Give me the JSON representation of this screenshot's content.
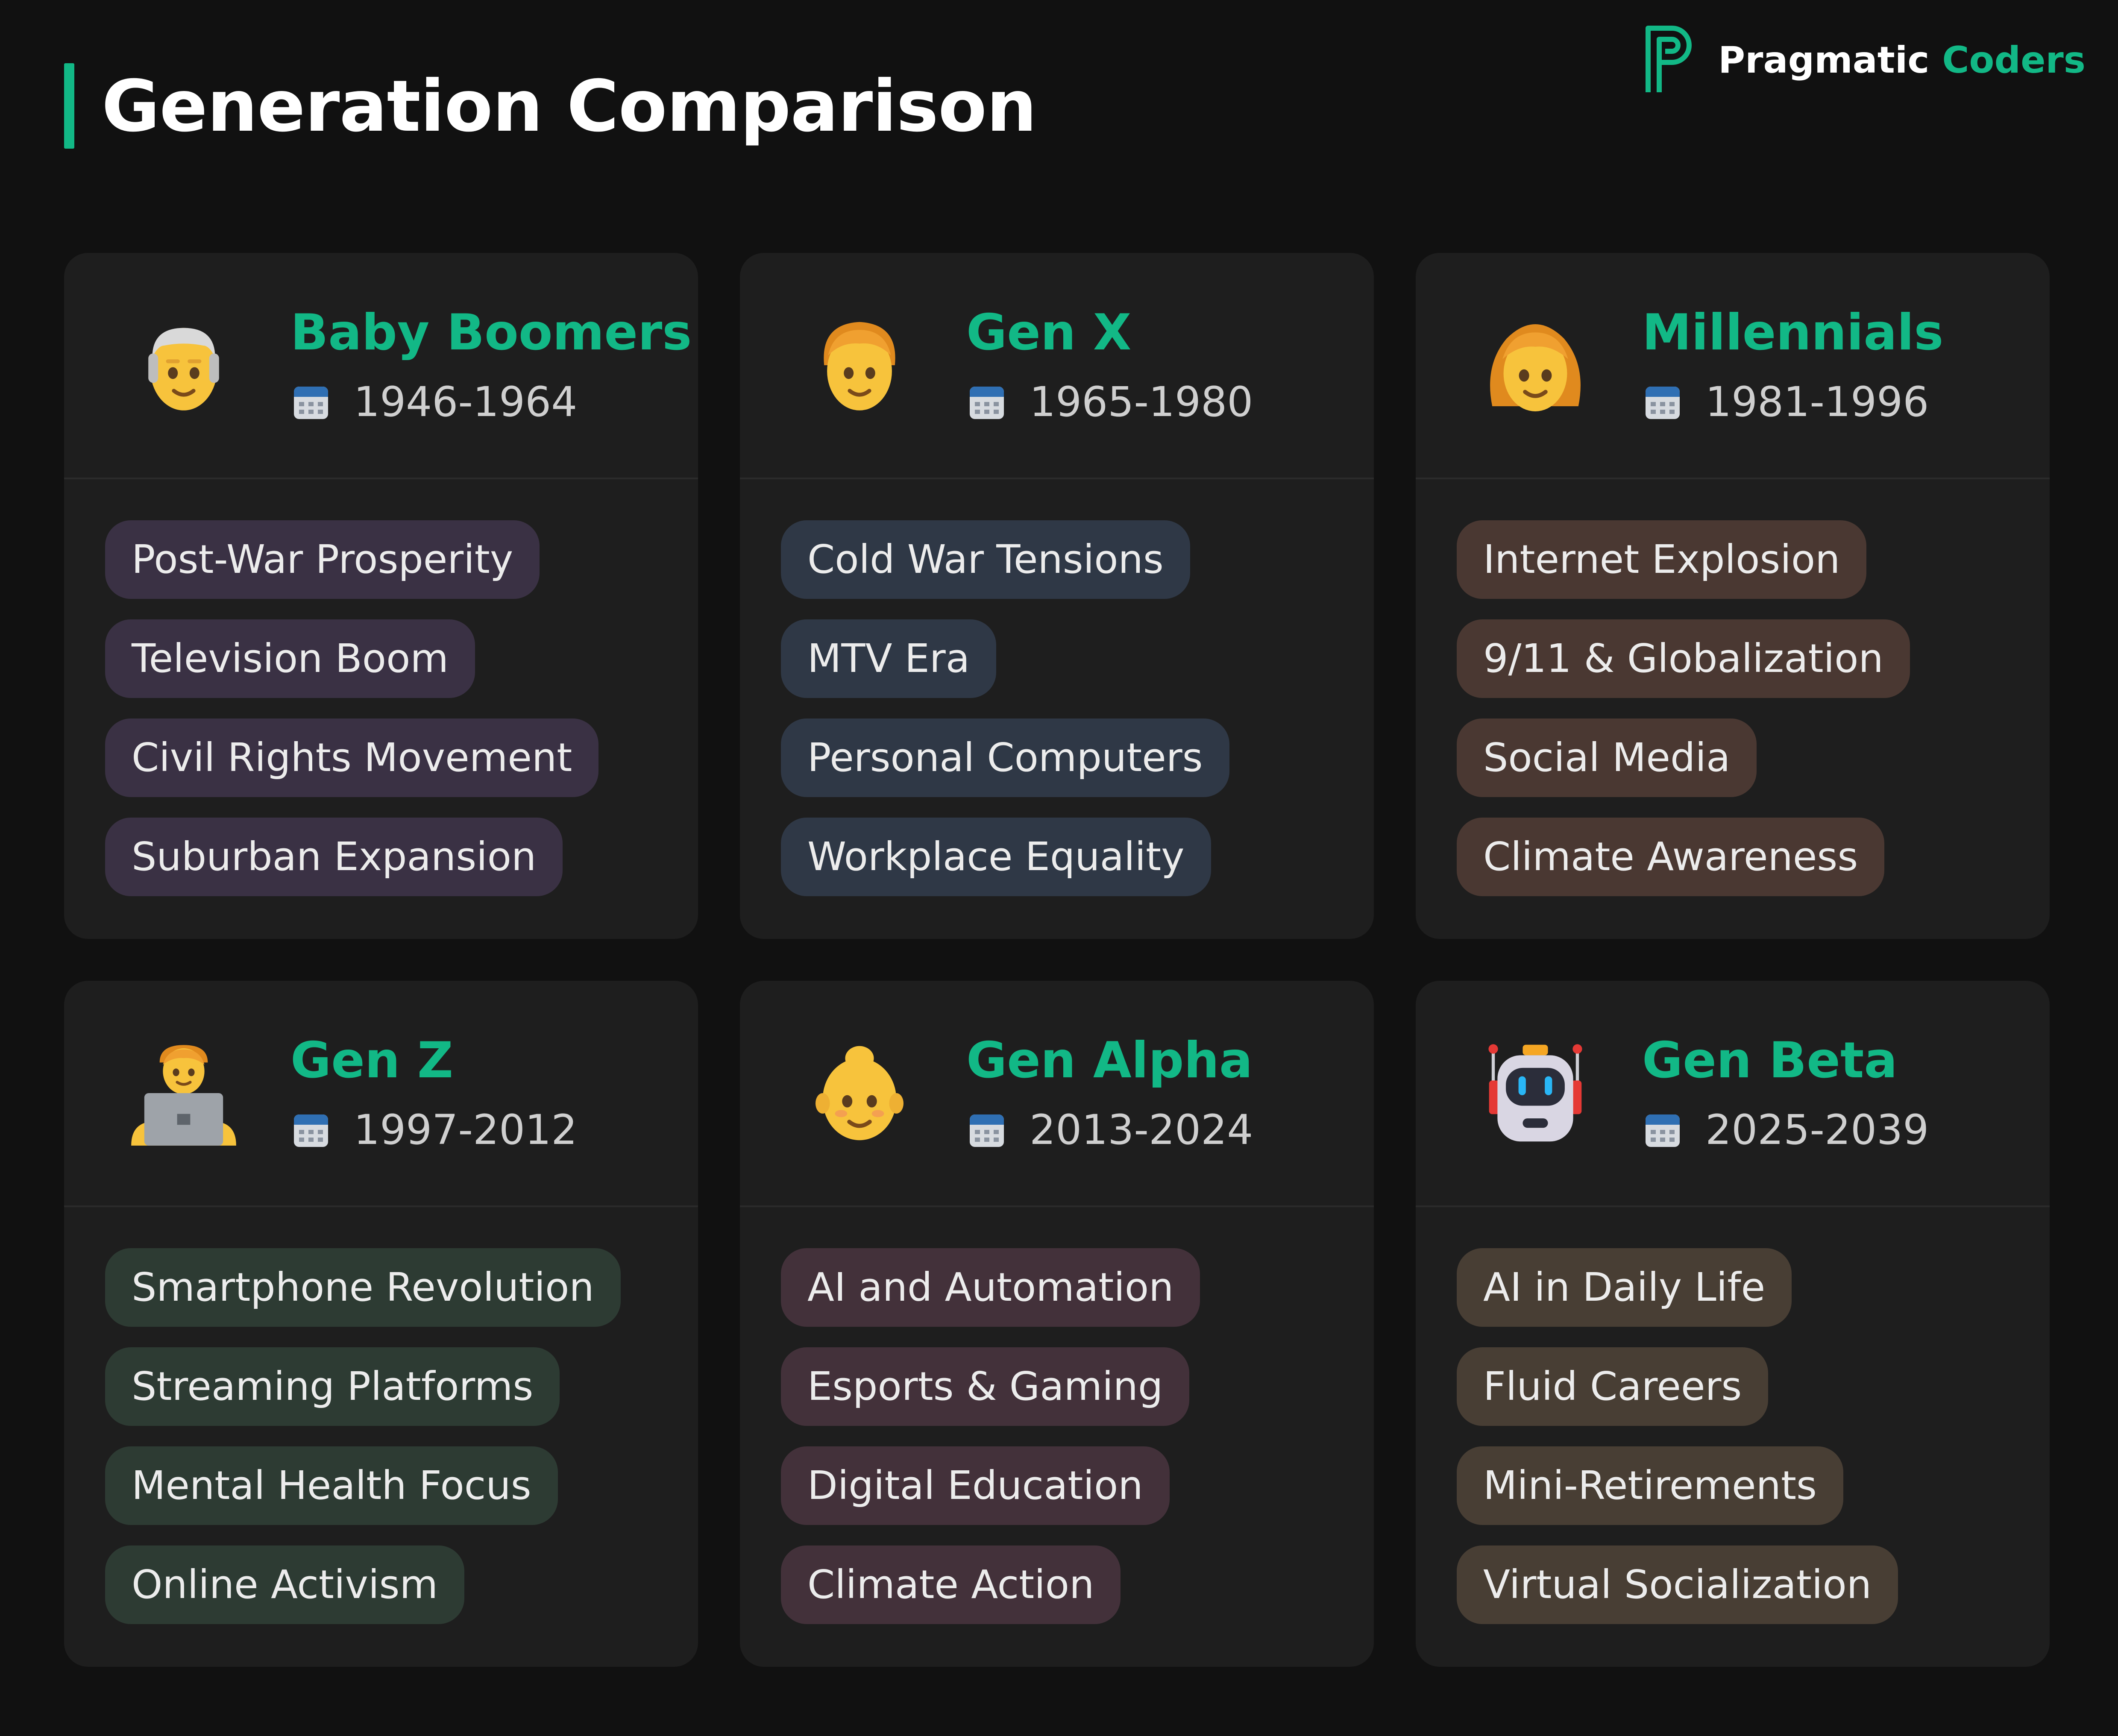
{
  "title": "Generation Comparison",
  "brand": {
    "name_part1": "Pragmatic",
    "name_part2": "Coders",
    "accent": "#12b886"
  },
  "generations": [
    {
      "name": "Baby Boomers",
      "years": "1946-1964",
      "icon": "older-person-icon",
      "tag_color": "#3a3144",
      "tags": [
        "Post-War Prosperity",
        "Television Boom",
        "Civil Rights Movement",
        "Suburban Expansion"
      ]
    },
    {
      "name": "Gen X",
      "years": "1965-1980",
      "icon": "person-icon",
      "tag_color": "#2f3846",
      "tags": [
        "Cold War Tensions",
        "MTV Era",
        "Personal Computers",
        "Workplace Equality"
      ]
    },
    {
      "name": "Millennials",
      "years": "1981-1996",
      "icon": "woman-icon",
      "tag_color": "#4a3832",
      "tags": [
        "Internet Explosion",
        "9/11 & Globalization",
        "Social Media",
        "Climate Awareness"
      ]
    },
    {
      "name": "Gen Z",
      "years": "1997-2012",
      "icon": "technologist-icon",
      "tag_color": "#2d3b33",
      "tags": [
        "Smartphone Revolution",
        "Streaming Platforms",
        "Mental Health Focus",
        "Online Activism"
      ]
    },
    {
      "name": "Gen Alpha",
      "years": "2013-2024",
      "icon": "baby-icon",
      "tag_color": "#43313a",
      "tags": [
        "AI and Automation",
        "Esports & Gaming",
        "Digital Education",
        "Climate Action"
      ]
    },
    {
      "name": "Gen Beta",
      "years": "2025-2039",
      "icon": "robot-icon",
      "tag_color": "#483e34",
      "tags": [
        "AI in Daily Life",
        "Fluid Careers",
        "Mini-Retirements",
        "Virtual Socialization"
      ]
    }
  ]
}
